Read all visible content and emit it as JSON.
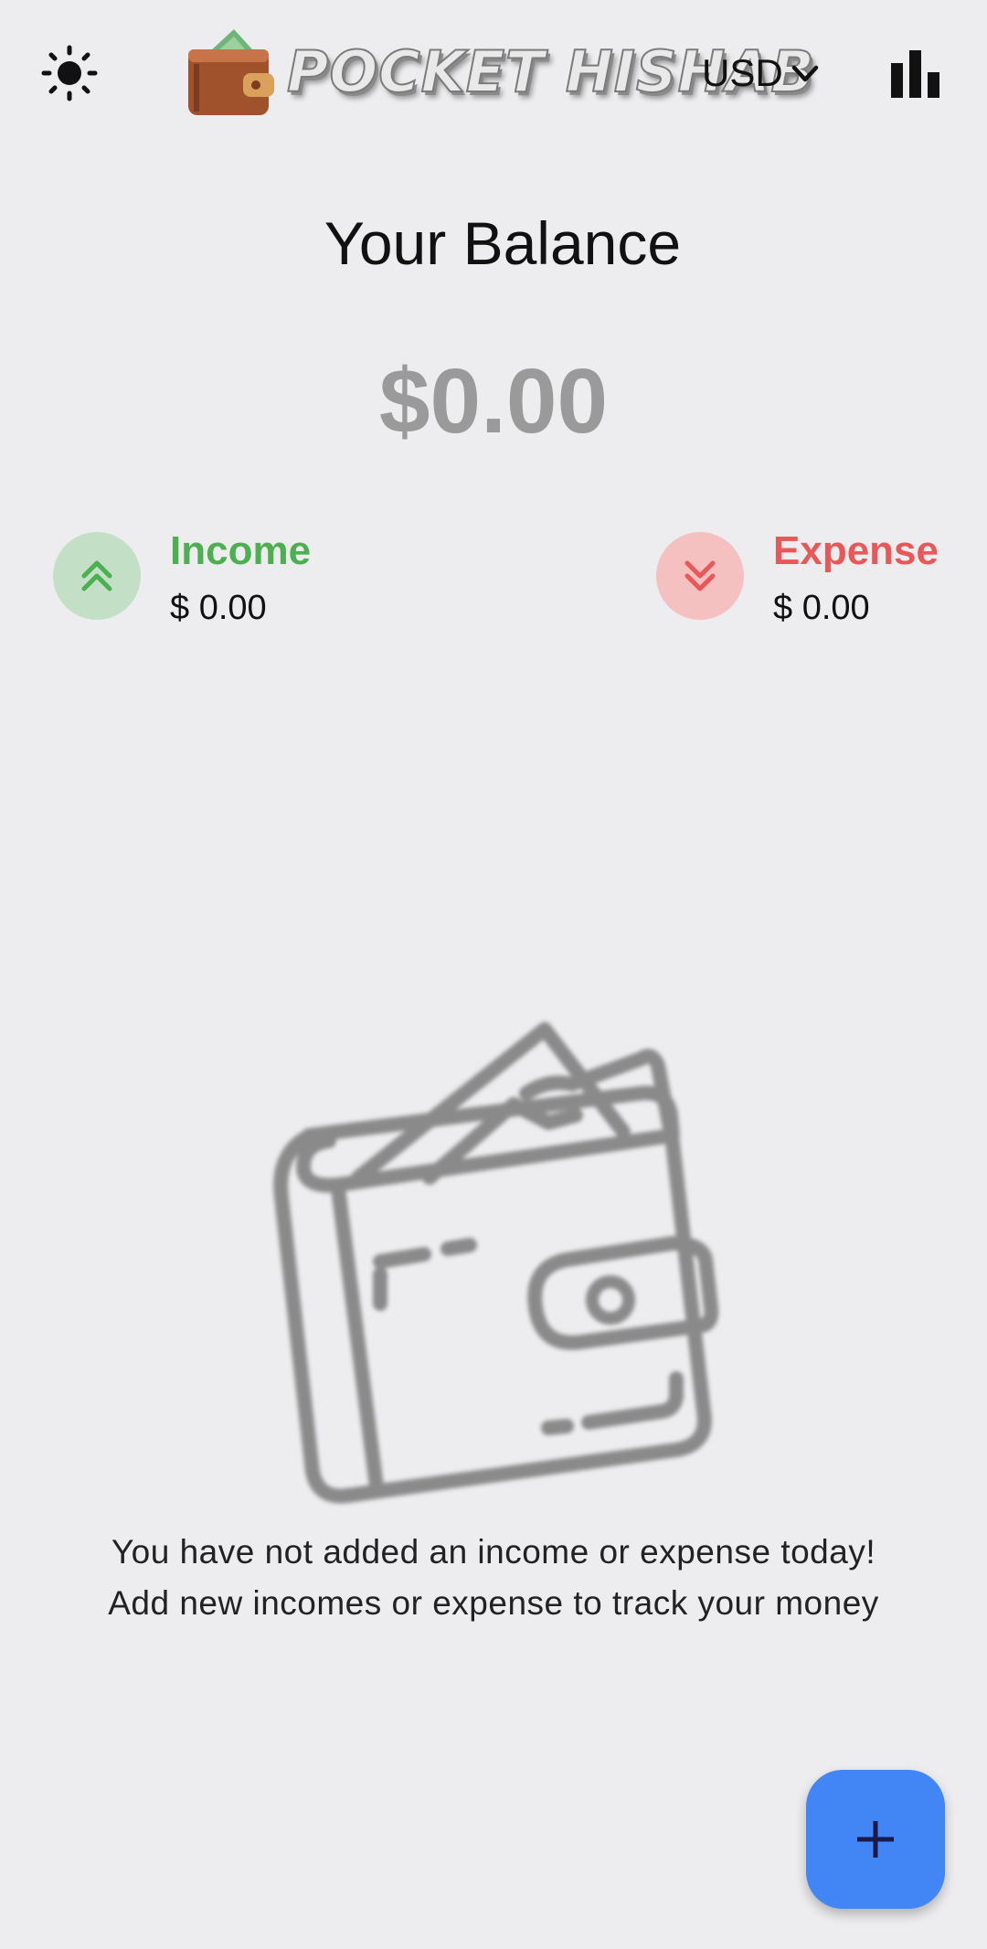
{
  "appbar": {
    "logo_text": "POCKET HISHAB",
    "currency": "USD",
    "icons": {
      "theme": "sun-icon",
      "currency_dropdown": "chevron-down-icon",
      "stats": "bar-chart-icon"
    }
  },
  "balance": {
    "title": "Your Balance",
    "amount": "$0.00"
  },
  "income": {
    "label": "Income",
    "value": "$ 0.00",
    "color": "#4caf50",
    "icon": "double-chevron-up-icon"
  },
  "expense": {
    "label": "Expense",
    "value": "$ 0.00",
    "color": "#e85858",
    "icon": "double-chevron-down-icon"
  },
  "empty_state": {
    "icon": "wallet-icon",
    "line1": "You have not added an income or expense today!",
    "line2": "Add new incomes or expense to track your money"
  },
  "fab": {
    "icon": "plus-icon",
    "color": "#4285f4"
  }
}
